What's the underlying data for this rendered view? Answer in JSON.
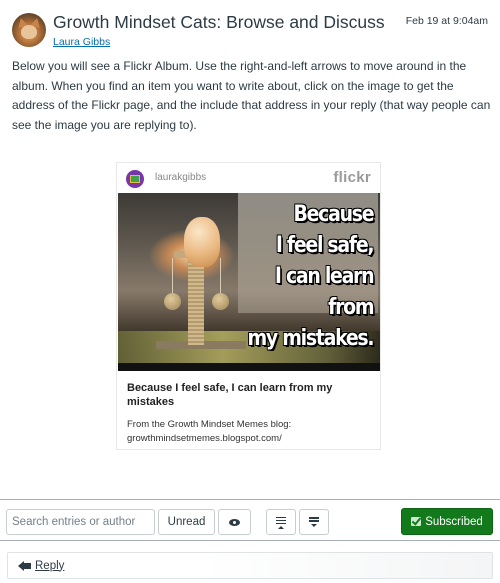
{
  "topic": {
    "title": "Growth Mindset Cats: Browse and Discuss",
    "author": "Laura Gibbs",
    "date": "Feb 19 at 9:04am",
    "body": "Below you will see a Flickr Album. Use the right-and-left arrows to move around in the album. When you find an item you want to write about, click on the image to get the address of the Flickr page, and the include that address in your reply (that way people can see the image you are replying to)."
  },
  "flickr_embed": {
    "username": "laurakgibbs",
    "logo": "flickr",
    "meme_lines": [
      "Because",
      "I feel safe,",
      "I can learn",
      "from",
      "my mistakes."
    ],
    "caption": "Because I feel safe, I can learn from my mistakes",
    "description_line1": "From the Growth Mindset Memes blog:",
    "description_line2": "growthmindsetmemes.blogspot.com/"
  },
  "toolbar": {
    "search_placeholder": "Search entries or author",
    "unread_label": "Unread",
    "eye_icon": "eye-icon",
    "collapse_icon": "collapse-threads-icon",
    "expand_icon": "expand-threads-icon",
    "subscribed_label": "Subscribed",
    "subscribed_color": "#127a1b"
  },
  "reply": {
    "label": "Reply",
    "icon": "reply-arrow-icon"
  }
}
